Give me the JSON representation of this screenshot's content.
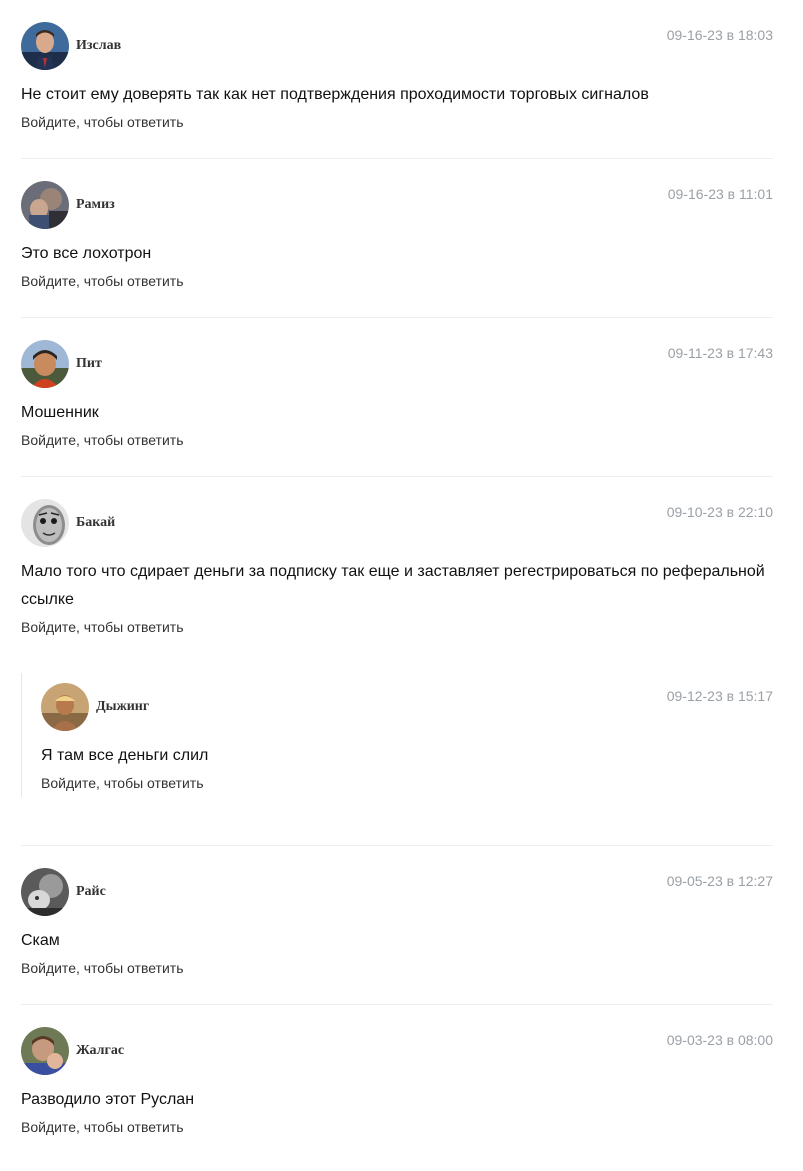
{
  "reply_prompt": "Войдите, чтобы ответить",
  "comments": [
    {
      "author": "Изслав",
      "date": "09-16-23 в 18:03",
      "text": "Не стоит ему доверять так как нет подтверждения проходимости торговых сигналов",
      "avatar": "avatar-icon"
    },
    {
      "author": "Рамиз",
      "date": "09-16-23 в 11:01",
      "text": "Это все лохотрон",
      "avatar": "avatar-icon"
    },
    {
      "author": "Пит",
      "date": "09-11-23 в 17:43",
      "text": "Мошенник",
      "avatar": "avatar-icon"
    },
    {
      "author": "Бакай",
      "date": "09-10-23 в 22:10",
      "text": "Мало того что сдирает деньги за подписку так еще и заставляет регестрироваться по реферальной ссылке",
      "avatar": "avatar-icon",
      "replies": [
        {
          "author": "Дыжинг",
          "date": "09-12-23 в 15:17",
          "text": "Я там все деньги слил",
          "avatar": "avatar-icon"
        }
      ]
    },
    {
      "author": "Райс",
      "date": "09-05-23 в 12:27",
      "text": "Скам",
      "avatar": "avatar-icon"
    },
    {
      "author": "Жалгас",
      "date": "09-03-23 в 08:00",
      "text": "Разводило этот Руслан",
      "avatar": "avatar-icon"
    }
  ]
}
